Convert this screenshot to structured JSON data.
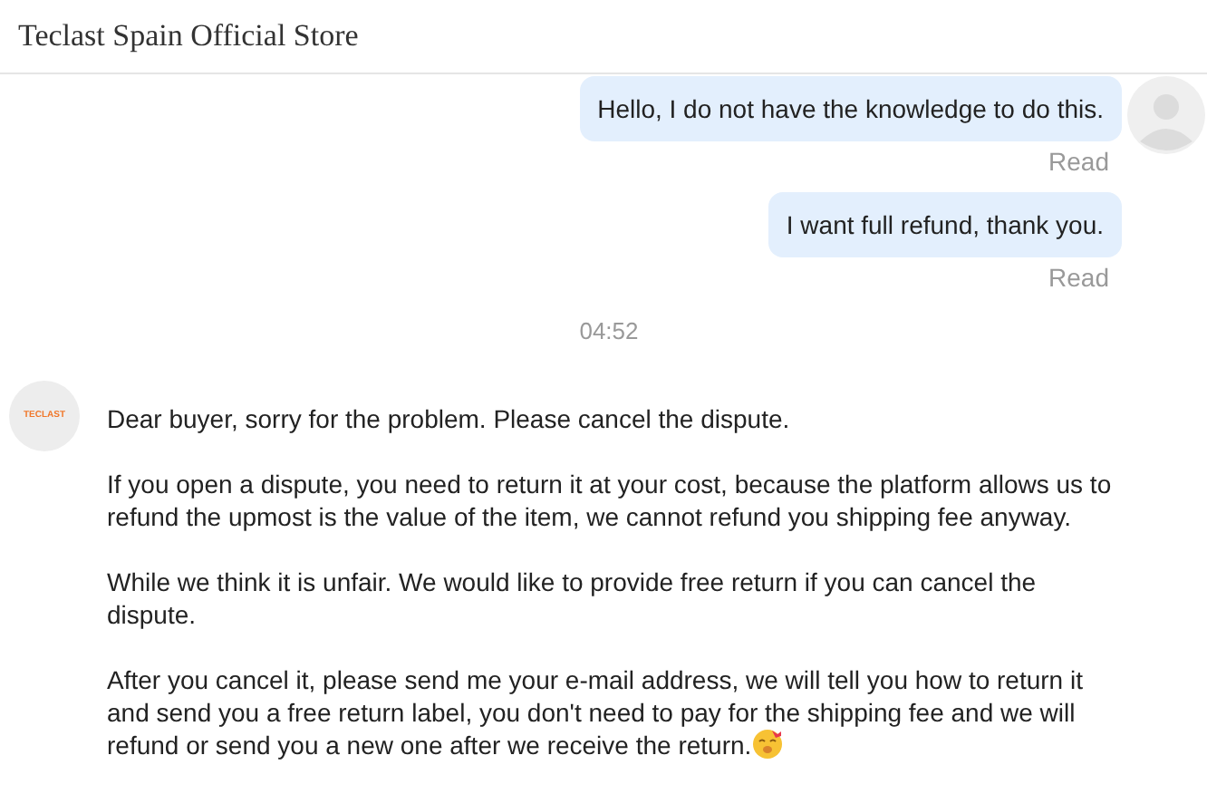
{
  "header": {
    "title": "Teclast Spain Official Store"
  },
  "messages": [
    {
      "kind": "sent",
      "text": "Hello, I do not have the knowledge to do this.",
      "status": "Read",
      "avatar": true
    },
    {
      "kind": "sent",
      "text": "I want full refund, thank you.",
      "status": "Read",
      "avatar": false
    },
    {
      "kind": "time",
      "text": "04:52"
    },
    {
      "kind": "received",
      "logo_text": "TECLAST",
      "paragraphs": [
        "Dear buyer, sorry for the problem. Please cancel the dispute.",
        "If you open a dispute, you need to return it at your cost, because the platform allows us to refund the upmost is the value of the item, we cannot refund you shipping fee anyway.",
        "While we think it is unfair. We would like to provide free return if you can cancel the dispute.",
        "After you cancel it, please send me your e-mail address, we will tell you how to return it and send you a free return label, you don't need to pay for the shipping fee and we will refund or send you a new one after we receive the return."
      ],
      "emoji": true
    }
  ]
}
